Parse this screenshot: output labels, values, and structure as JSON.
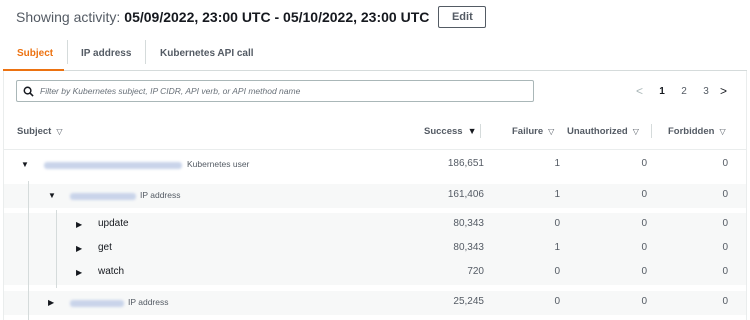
{
  "header": {
    "label": "Showing activity:",
    "range": "05/09/2022, 23:00 UTC - 05/10/2022, 23:00 UTC",
    "edit_label": "Edit"
  },
  "tabs": [
    {
      "label": "Subject",
      "active": true
    },
    {
      "label": "IP address",
      "active": false
    },
    {
      "label": "Kubernetes API call",
      "active": false
    }
  ],
  "search": {
    "placeholder": "Filter by Kubernetes subject, IP CIDR, API verb, or API method name",
    "icon": "search-icon"
  },
  "pagination": {
    "prev": "<",
    "pages": [
      "1",
      "2",
      "3"
    ],
    "current": "1",
    "next": ">"
  },
  "columns": {
    "subject": "Subject",
    "success": "Success",
    "failure": "Failure",
    "unauthorized": "Unauthorized",
    "forbidden": "Forbidden"
  },
  "rows": [
    {
      "toggle": "▼",
      "type": "Kubernetes user",
      "success": "186,651",
      "failure": "1",
      "unauthorized": "0",
      "forbidden": "0"
    },
    {
      "toggle": "▼",
      "type": "IP address",
      "success": "161,406",
      "failure": "1",
      "unauthorized": "0",
      "forbidden": "0"
    },
    {
      "toggle": "▶",
      "name": "update",
      "success": "80,343",
      "failure": "0",
      "unauthorized": "0",
      "forbidden": "0"
    },
    {
      "toggle": "▶",
      "name": "get",
      "success": "80,343",
      "failure": "1",
      "unauthorized": "0",
      "forbidden": "0"
    },
    {
      "toggle": "▶",
      "name": "watch",
      "success": "720",
      "failure": "0",
      "unauthorized": "0",
      "forbidden": "0"
    },
    {
      "toggle": "▶",
      "type": "IP address",
      "success": "25,245",
      "failure": "0",
      "unauthorized": "0",
      "forbidden": "0"
    }
  ],
  "colors": {
    "accent": "#ec7211",
    "text": "#16191f",
    "muted": "#545b64"
  }
}
